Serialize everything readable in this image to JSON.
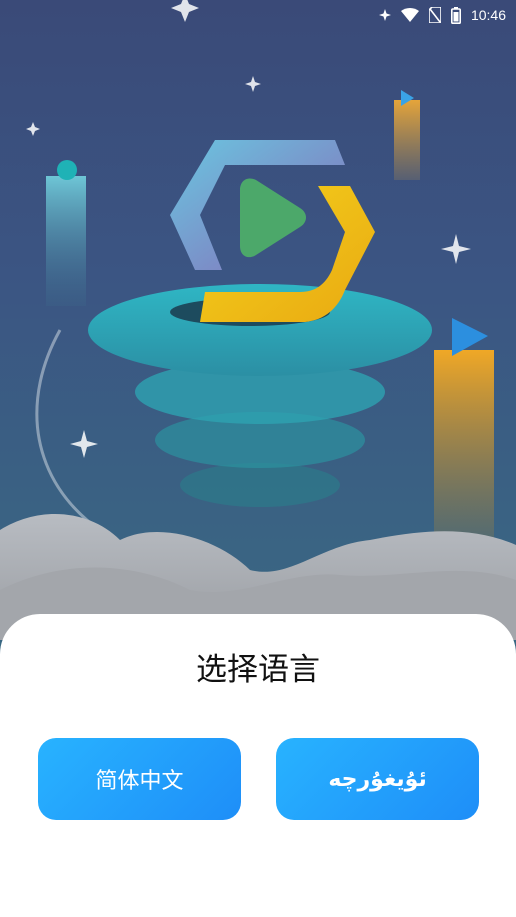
{
  "status_bar": {
    "time": "10:46",
    "icons": [
      "sparkle-icon",
      "wifi-icon",
      "no-sim-icon",
      "battery-icon"
    ]
  },
  "language_dialog": {
    "title": "选择语言",
    "options": [
      {
        "label": "简体中文"
      },
      {
        "label": "ئۇيغۇرچە"
      }
    ]
  },
  "colors": {
    "background_top": "#3a4a78",
    "background_bottom": "#35707d",
    "button_gradient_start": "#28b3ff",
    "button_gradient_end": "#1e8ef8",
    "sheet": "#ffffff"
  }
}
